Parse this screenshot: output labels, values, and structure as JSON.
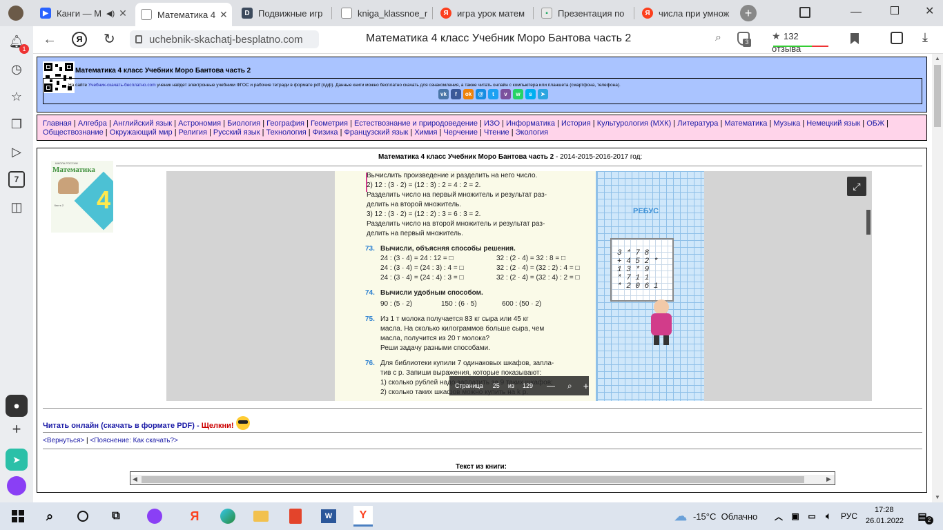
{
  "tabs": [
    {
      "title": "Канги — М",
      "icon_color": "#2962ff",
      "icon_char": "▶"
    },
    {
      "title": "Математика 4",
      "icon_color": "#ffffff",
      "icon_char": ""
    },
    {
      "title": "Подвижные игр",
      "icon_color": "#3c4a5c",
      "icon_char": "D"
    },
    {
      "title": "kniga_klassnoe_r",
      "icon_color": "#ffffff",
      "icon_char": ""
    },
    {
      "title": "игра урок матем",
      "icon_color": "#fc3f1d",
      "icon_char": "Я"
    },
    {
      "title": "Презентация по",
      "icon_color": "#ffffff",
      "icon_char": "▪"
    },
    {
      "title": "числа при умнож",
      "icon_color": "#fc3f1d",
      "icon_char": "Я"
    }
  ],
  "address": {
    "url": "uchebnik-skachatj-besplatno.com",
    "page_title": "Математика 4 класс Учебник Моро Бантова часть 2",
    "reviews": "132 отзыва",
    "ext_badge": "3"
  },
  "sidebar": {
    "notif_badge": "1",
    "seven": "7"
  },
  "header": {
    "title": "Математика 4 класс Учебник Моро Бантова часть 2",
    "desc_prefix": "На сайте ",
    "desc_link": "Учебник-скачать-бесплатно.com",
    "desc_rest": " ученик найдет электронные учебники ФГОС и рабочие тетради в формате pdf (пдф). Данные книги можно бесплатно скачать для ознакомления, а также читать онлайн с компьютера или планшета (смартфона, телефона).",
    "share_icons": [
      {
        "name": "vk",
        "char": "vk",
        "color": "#4a76a8"
      },
      {
        "name": "facebook",
        "char": "f",
        "color": "#3b5998"
      },
      {
        "name": "odnoklassniki",
        "char": "ok",
        "color": "#ee8208"
      },
      {
        "name": "moimir",
        "char": "@",
        "color": "#168de2"
      },
      {
        "name": "twitter",
        "char": "t",
        "color": "#1da1f2"
      },
      {
        "name": "viber",
        "char": "v",
        "color": "#7b519d"
      },
      {
        "name": "whatsapp",
        "char": "w",
        "color": "#25d366"
      },
      {
        "name": "skype",
        "char": "s",
        "color": "#00aff0"
      },
      {
        "name": "telegram",
        "char": "➤",
        "color": "#2ca5e0"
      }
    ]
  },
  "nav": {
    "line1": [
      "Главная",
      "Алгебра",
      "Английский язык",
      "Астрономия",
      "Биология",
      "География",
      "Геометрия",
      "Естествознание и природоведение",
      "ИЗО",
      "Информатика",
      "История",
      "Культурология (МХК)",
      "Литература",
      "Математика",
      "Музыка",
      "Немецкий язык",
      "ОБЖ"
    ],
    "line2": [
      "Обществознание",
      "Окружающий мир",
      "Религия",
      "Русский язык",
      "Технология",
      "Физика",
      "Французский язык",
      "Химия",
      "Черчение",
      "Чтение",
      "Экология"
    ]
  },
  "main": {
    "heading_bold": "Математика 4 класс Учебник Моро Бантова часть 2",
    "heading_rest": " - 2014-2015-2016-2017 год:",
    "cover": {
      "series": "ШКОЛА РОССИИ",
      "title": "Математика",
      "grade": "4",
      "part": "Часть 2"
    },
    "viewer": {
      "page_label": "Страница",
      "page_num": "25",
      "of_label": "из",
      "total": "129",
      "rebus_title": "РЕБУС",
      "rebus_rows": [
        "3 * 7 8",
        "+ 4 5 2 *",
        "1 3 * 9",
        "* 7 1 1",
        "* 2 0 6 1"
      ],
      "lines": [
        "Вычислить произведение и разделить на него число.",
        "2)  12 : (3 · 2) = (12 : 3) : 2 = 4 : 2 = 2.",
        "Разделить число на первый множитель и результат раз-",
        "делить на второй множитель.",
        "3)  12 : (3 · 2) = (12 : 2) : 3 = 6 : 3 = 2.",
        "Разделить число на второй множитель и результат раз-",
        "делить на первый множитель."
      ],
      "ex73_num": "73.",
      "ex73_title": "Вычисли, объясняя способы решения.",
      "ex73_left": [
        "24 : (3 · 4) = 24 : 12 = □",
        "24 : (3 · 4) = (24 : 3) : 4 = □",
        "24 : (3 · 4) = (24 : 4) : 3 = □"
      ],
      "ex73_right": [
        "32 : (2 · 4) = 32 : 8 = □",
        "32 : (2 · 4) = (32 : 2) : 4 = □",
        "32 : (2 · 4) = (32 : 4) : 2 = □"
      ],
      "ex74_num": "74.",
      "ex74_title": "Вычисли удобным способом.",
      "ex74_items": [
        "90 : (5 · 2)",
        "150 : (6 · 5)",
        "600 : (50 · 2)"
      ],
      "ex75_num": "75.",
      "ex75_lines": [
        "Из 1 т молока получается 83 кг сыра или 45 кг",
        "масла. На сколько килограммов больше сыра, чем",
        "масла, получится из 20 т молока?",
        "Реши задачу разными способами."
      ],
      "ex76_num": "76.",
      "ex76_lines": [
        "Для библиотеки купили 7 одинаковых шкафов, запла-",
        "тив с р. Запиши выражения, которые показывают:",
        "1) сколько рублей надо заплатить за 9 таких шкафов;",
        "2) сколько таких шкафов можно купить на k р."
      ]
    },
    "read_online": "Читать онлайн (скачать в формате PDF) - ",
    "click": "Щелкни!",
    "back": "<Вернуться>",
    "sep": " | ",
    "explain": "<Пояснение: Как скачать?>",
    "book_text_label": "Текст из книги:"
  },
  "taskbar": {
    "weather": "-15°C  Облачно",
    "lang": "РУС",
    "time": "17:28",
    "date": "26.01.2022",
    "notif": "2"
  }
}
